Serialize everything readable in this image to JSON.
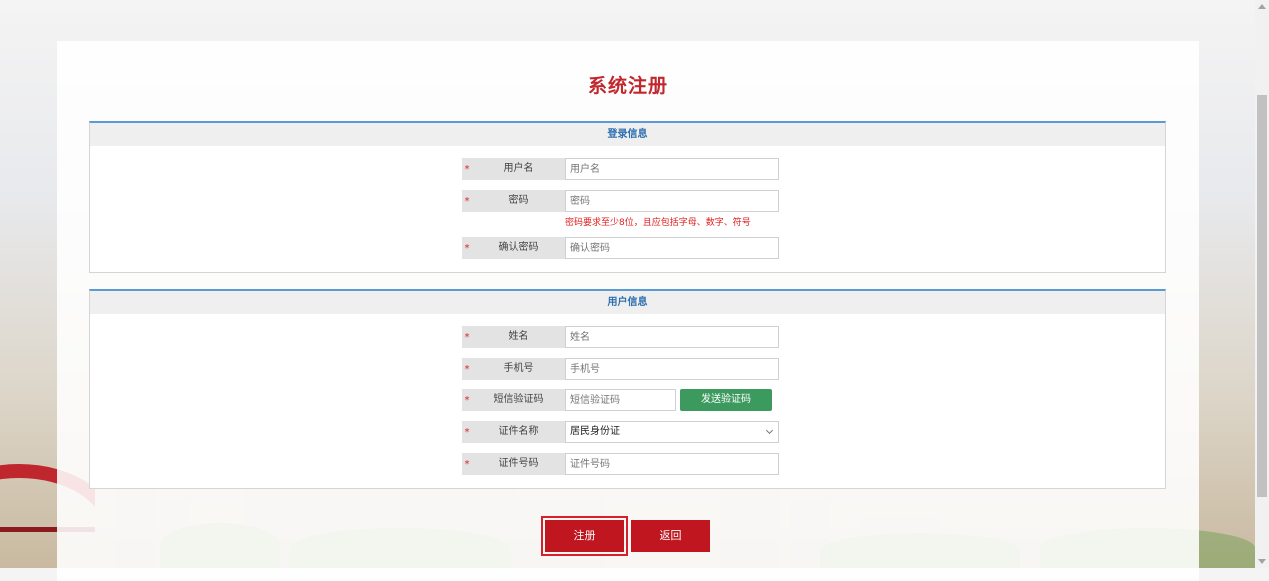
{
  "page_title": "系统注册",
  "login_section": {
    "title": "登录信息",
    "fields": [
      {
        "label": "用户名",
        "placeholder": "用户名"
      },
      {
        "label": "密码",
        "placeholder": "密码"
      },
      {
        "label": "确认密码",
        "placeholder": "确认密码"
      }
    ],
    "password_hint": "密码要求至少8位，且应包括字母、数字、符号"
  },
  "user_section": {
    "title": "用户信息",
    "fields": [
      {
        "label": "姓名",
        "placeholder": "姓名"
      },
      {
        "label": "手机号",
        "placeholder": "手机号"
      },
      {
        "label": "短信验证码",
        "placeholder": "短信验证码"
      },
      {
        "label": "证件名称",
        "value": "居民身份证"
      },
      {
        "label": "证件号码",
        "placeholder": "证件号码"
      }
    ],
    "send_code_label": "发送验证码"
  },
  "required_mark": "*",
  "buttons": {
    "register": "注册",
    "back": "返回"
  },
  "colors": {
    "title": "#c1272d",
    "primary_button": "#c0161f",
    "sms_button": "#3d9a5f",
    "section_accent": "#5a9bd5"
  }
}
